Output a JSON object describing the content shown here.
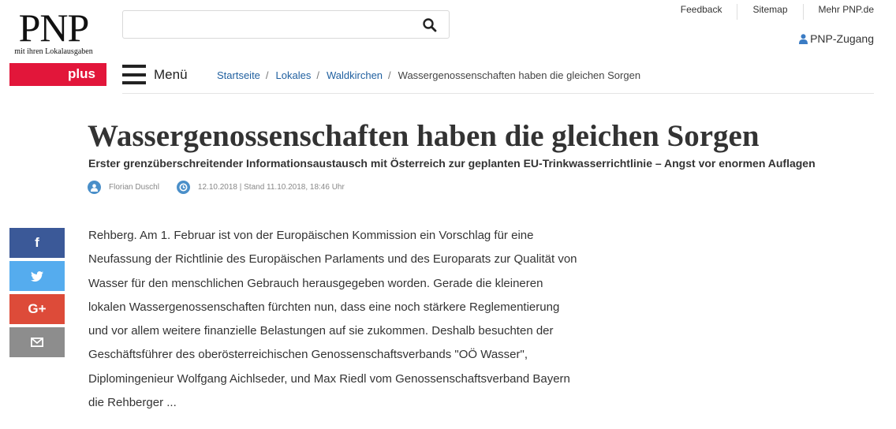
{
  "logo": {
    "brand": "PNP",
    "tagline": "mit ihren Lokalausgaben",
    "plus_label": "plus"
  },
  "search": {
    "placeholder": "",
    "value": ""
  },
  "top_links": [
    "Feedback",
    "Sitemap",
    "Mehr PNP.de"
  ],
  "login": {
    "label": "PNP-Zugang"
  },
  "menu": {
    "label": "Menü"
  },
  "breadcrumb": [
    "Startseite",
    "Lokales",
    "Waldkirchen",
    "Wassergenossenschaften haben die gleichen Sorgen"
  ],
  "article": {
    "title": "Wassergenossenschaften haben die gleichen Sorgen",
    "subtitle": "Erster grenzüberschreitender Informationsaustausch mit Österreich zur geplanten EU-Trinkwasserrichtlinie – Angst vor enormen Auflagen",
    "author": "Florian Duschl",
    "date": "12.10.2018 | Stand 11.10.2018, 18:46 Uhr",
    "body_lines": [
      "Rehberg. Am 1. Februar ist von der Europäischen Kommission ein Vorschlag für eine",
      "Neufassung der Richtlinie des Europäischen Parlaments und des Europarats zur Qualität von",
      "Wasser für den menschlichen Gebrauch herausgegeben worden. Gerade die kleineren",
      "lokalen Wassergenossenschaften fürchten nun, dass eine noch stärkere Reglementierung",
      "und vor allem weitere finanzielle Belastungen auf sie zukommen. Deshalb besuchten der",
      "Geschäftsführer des oberösterreichischen Genossenschaftsverbands \"OÖ Wasser\",",
      "Diplomingenieur Wolfgang Aichlseder, und Max Riedl vom Genossenschaftsverband Bayern",
      "die Rehberger ..."
    ]
  },
  "share": {
    "facebook": "f",
    "googleplus": "G+",
    "icons": [
      "facebook-icon",
      "twitter-icon",
      "google-plus-icon",
      "mail-icon"
    ]
  },
  "colors": {
    "accent_red": "#e2163a",
    "link_blue": "#1f5f9f",
    "meta_blue": "#4a8fc9",
    "facebook": "#3b5998",
    "twitter": "#55acee",
    "googleplus": "#dd4b39",
    "mail": "#8d8d8d"
  }
}
